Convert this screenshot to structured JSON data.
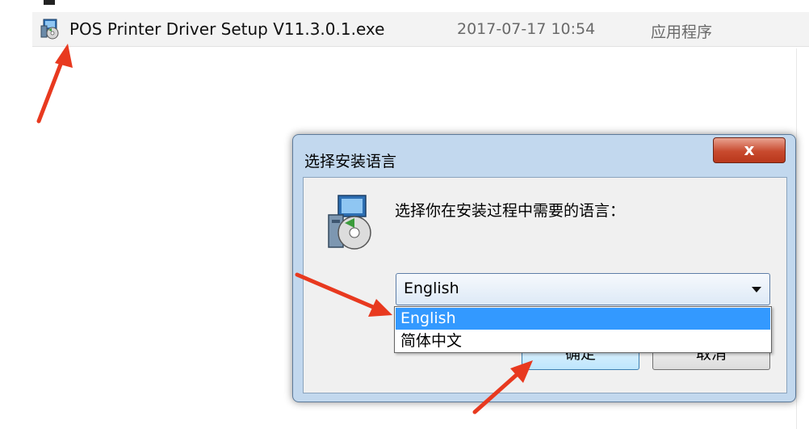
{
  "file_row": {
    "name": "POS Printer Driver Setup V11.3.0.1.exe",
    "modified": "2017-07-17 10:54",
    "type": "应用程序",
    "icon": "installer-icon"
  },
  "dialog": {
    "title": "选择安装语言",
    "close_label": "x",
    "prompt": "选择你在安装过程中需要的语言：",
    "select_value": "English",
    "options": [
      "English",
      "简体中文"
    ],
    "ok_label": "确定",
    "cancel_label": "取消"
  },
  "colors": {
    "highlight": "#3399ff",
    "arrow": "#e8391f",
    "close_button": "#c84a2e"
  }
}
